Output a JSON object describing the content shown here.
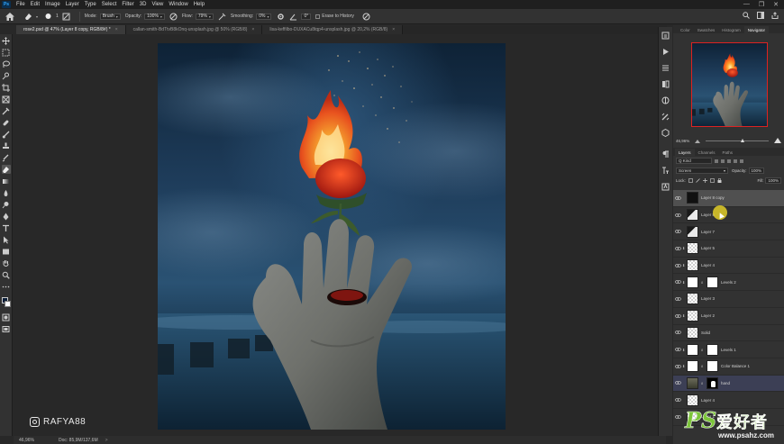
{
  "app": {
    "logo_text": "Ps"
  },
  "menu": [
    "File",
    "Edit",
    "Image",
    "Layer",
    "Type",
    "Select",
    "Filter",
    "3D",
    "View",
    "Window",
    "Help"
  ],
  "window_controls": [
    "—",
    "❐",
    "✕"
  ],
  "options_bar": {
    "brush_size": "1",
    "mode_label": "Mode:",
    "mode_value": "Brush",
    "opacity_label": "Opacity:",
    "opacity_value": "100%",
    "flow_label": "Flow:",
    "flow_value": "79%",
    "smoothing_label": "Smoothing:",
    "smoothing_value": "0%",
    "angle_value": "0°",
    "erase_history_label": "Erase to History"
  },
  "tabs": [
    {
      "label": "rose2.psd @ 47% (Layer 8 copy, RGB/8#) *",
      "close": "×"
    },
    {
      "label": "callan-smith-BdTtvB8kOnq-unsplash.jpg @ 50% (RGB/8)",
      "close": "×"
    },
    {
      "label": "lisa-keffilbo-DUXACu8tqp4-unsplash.jpg @ 20,2% (RGB/8)",
      "close": "×"
    }
  ],
  "watermark_user": "RAFYA88",
  "status": {
    "zoom": "46,96%",
    "doc": "Doc: 85,9M/137,6M",
    "arrow": ">"
  },
  "navigator": {
    "tabs": [
      "Color",
      "Swatches",
      "Histogram",
      "Navigator"
    ],
    "active_tab": "Navigator",
    "zoom_value": "46,96%",
    "zoom_fraction": 0.55
  },
  "layers_panel": {
    "tabs": [
      "Layers",
      "Channels",
      "Paths"
    ],
    "active_tab": "Layers",
    "filter_label": "Q Kind",
    "blend_mode": "Screen",
    "opacity_label": "Opacity:",
    "opacity_value": "100%",
    "lock_label": "Lock:",
    "fill_label": "Fill:",
    "fill_value": "100%",
    "layers": [
      {
        "name": "Layer 8 copy",
        "thumb": "dark",
        "selected": true,
        "clip": ""
      },
      {
        "name": "Layer 8",
        "thumb": "mixed",
        "selected": false,
        "clip": ""
      },
      {
        "name": "Layer 7",
        "thumb": "mixed",
        "selected": false,
        "clip": ""
      },
      {
        "name": "Layer 5",
        "thumb": "checker",
        "selected": false,
        "clip": "⬇"
      },
      {
        "name": "Layer 4",
        "thumb": "checker",
        "selected": false,
        "clip": "⬇"
      },
      {
        "name": "Levels 2",
        "thumb": "adj",
        "mask": "white",
        "selected": false,
        "clip": "⬇"
      },
      {
        "name": "Layer 3",
        "thumb": "checker",
        "selected": false,
        "clip": ""
      },
      {
        "name": "Layer 2",
        "thumb": "checker",
        "selected": false,
        "clip": "⬇"
      },
      {
        "name": "Solid",
        "thumb": "checker",
        "selected": false,
        "clip": ""
      },
      {
        "name": "Levels 1",
        "thumb": "adj",
        "mask": "white",
        "selected": false,
        "clip": "⬇"
      },
      {
        "name": "Color Balance 1",
        "thumb": "adj",
        "mask": "white",
        "selected": false,
        "clip": "⬇"
      },
      {
        "name": "hand",
        "thumb": "photo",
        "mask": "black",
        "selected": false,
        "clip": "",
        "blue": true
      },
      {
        "name": "Layer 4",
        "thumb": "checker",
        "selected": false,
        "clip": ""
      },
      {
        "name": "Layer 1",
        "thumb": "checker",
        "selected": false,
        "clip": ""
      }
    ]
  },
  "site_logo": {
    "ps": "PS",
    "cn": "爱好者",
    "url": "www.psahz.com"
  },
  "colors": {
    "accent_blue": "#31a8ff",
    "fire": "#ff6a1a",
    "sky": "#1b3a5c"
  }
}
